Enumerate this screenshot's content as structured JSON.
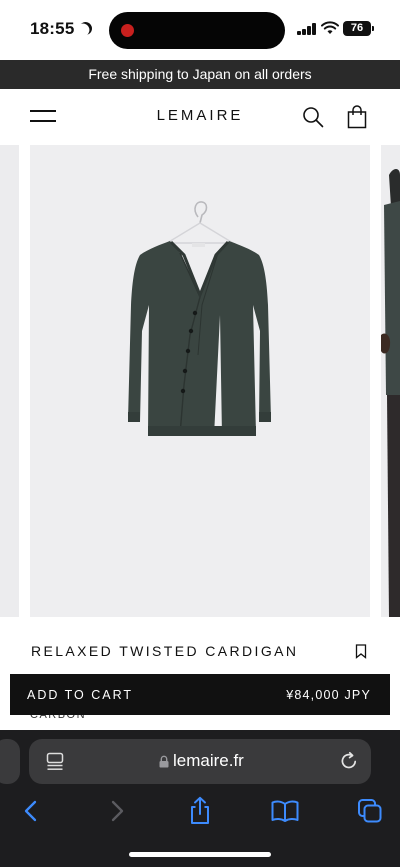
{
  "status_bar": {
    "time": "18:55",
    "battery": "76"
  },
  "promo_banner": {
    "text": "Free shipping to Japan on all orders"
  },
  "header": {
    "logo": "LEMAIRE",
    "icons": [
      "menu-icon",
      "search-icon",
      "shopping-bag-icon"
    ]
  },
  "product": {
    "title": "RELAXED TWISTED CARDIGAN",
    "color": "CARBON",
    "garment_color": "#38433f",
    "image_background": "#eeeef0"
  },
  "cart_bar": {
    "label": "ADD TO CART",
    "price": "¥84,000 JPY"
  },
  "browser": {
    "url": "lemaire.fr",
    "icons": [
      "reader-icon",
      "lock-icon",
      "reload-icon",
      "back-icon",
      "forward-icon",
      "share-icon",
      "bookmarks-icon",
      "tabs-icon"
    ],
    "accent": "#3d8bfd"
  }
}
